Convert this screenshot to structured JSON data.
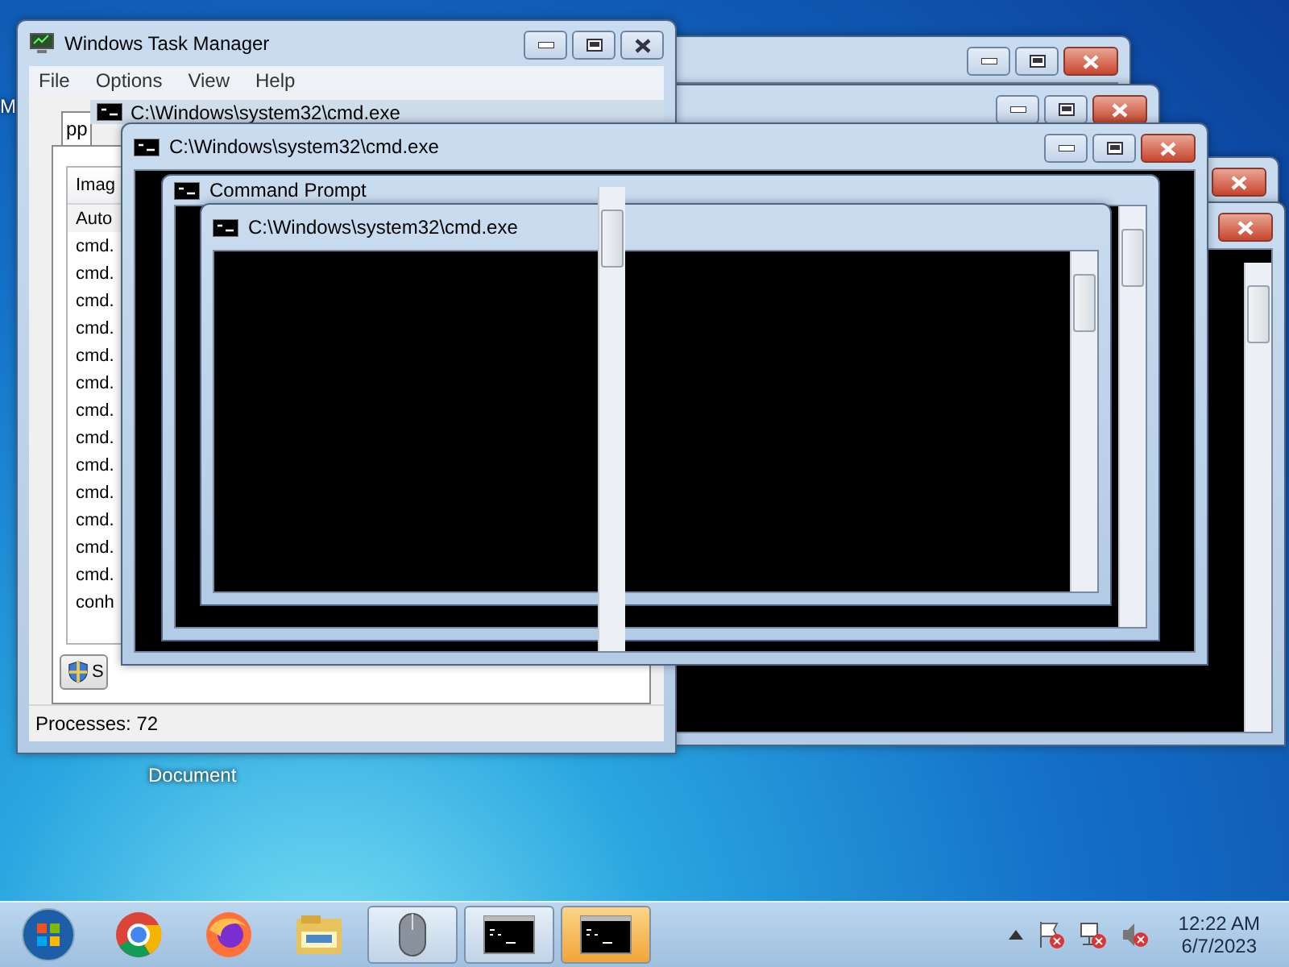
{
  "desktop_icons": [
    {
      "label": "M"
    },
    {
      "label": "Document"
    }
  ],
  "task_manager": {
    "title": "Windows Task Manager",
    "menu": [
      "File",
      "Options",
      "View",
      "Help"
    ],
    "tab": "pp",
    "column": "Imag",
    "processes": [
      "Auto",
      "cmd.",
      "cmd.",
      "cmd.",
      "cmd.",
      "cmd.",
      "cmd.",
      "cmd.",
      "cmd.",
      "cmd.",
      "cmd.",
      "cmd.",
      "cmd.",
      "cmd.",
      "conh"
    ],
    "button": "S",
    "status": "Processes: 72"
  },
  "ghost_window": {
    "title": "C:\\Windows\\system32\\cmd.exe"
  },
  "console_window": {
    "title": "C:\\Windows\\system32\\cmd.exe",
    "inner_windows": [
      {
        "title": "Command Prompt"
      },
      {
        "title": "C:\\Windows\\system32\\cmd.exe"
      }
    ]
  },
  "taskbar": {
    "items": [
      {
        "kind": "start",
        "open": false,
        "flashing": false
      },
      {
        "kind": "chrome",
        "open": false,
        "flashing": false
      },
      {
        "kind": "firefox",
        "open": false,
        "flashing": false
      },
      {
        "kind": "folder",
        "open": false,
        "flashing": false
      },
      {
        "kind": "mouse",
        "open": true,
        "flashing": false
      },
      {
        "kind": "console",
        "open": true,
        "flashing": false
      },
      {
        "kind": "console",
        "open": true,
        "flashing": true
      }
    ],
    "clock": {
      "time": "12:22 AM",
      "date": "6/7/2023"
    }
  }
}
